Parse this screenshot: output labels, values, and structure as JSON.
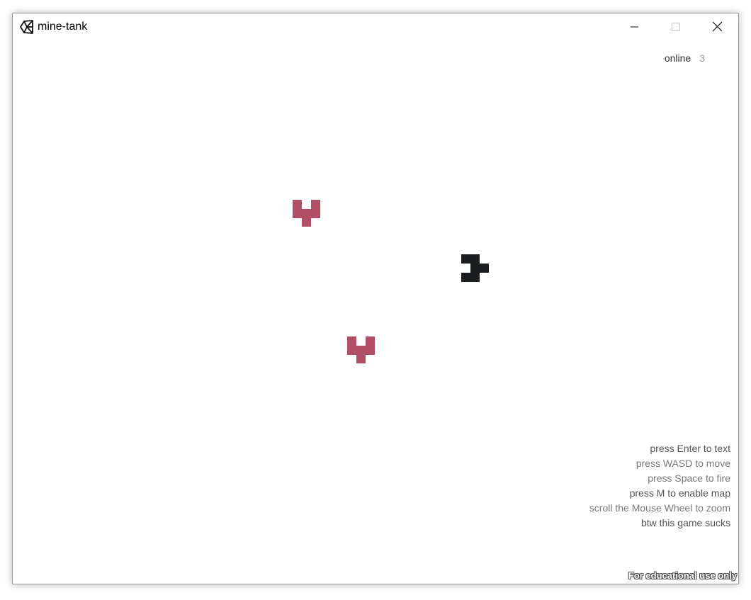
{
  "window": {
    "title": "mine-tank",
    "icon": "unity-logo-icon",
    "controls": {
      "minimize_icon": "minimize-icon",
      "maximize_icon": "maximize-icon",
      "close_icon": "close-icon"
    }
  },
  "hud": {
    "online_label": "online",
    "online_count": "3"
  },
  "tanks": [
    {
      "color": "#b04f66",
      "facing": "down"
    },
    {
      "color": "#b04f66",
      "facing": "down"
    },
    {
      "color": "#1a1e1f",
      "facing": "right"
    }
  ],
  "help": {
    "lines": [
      "press Enter to text",
      "press WASD to move",
      "press Space to fire",
      "press M to enable map",
      "scroll the Mouse Wheel to zoom",
      "btw this game sucks"
    ]
  },
  "watermark": "For educational use only",
  "colors": {
    "enemy": "#b04f66",
    "player": "#1a1e1f",
    "background": "#ffffff"
  }
}
